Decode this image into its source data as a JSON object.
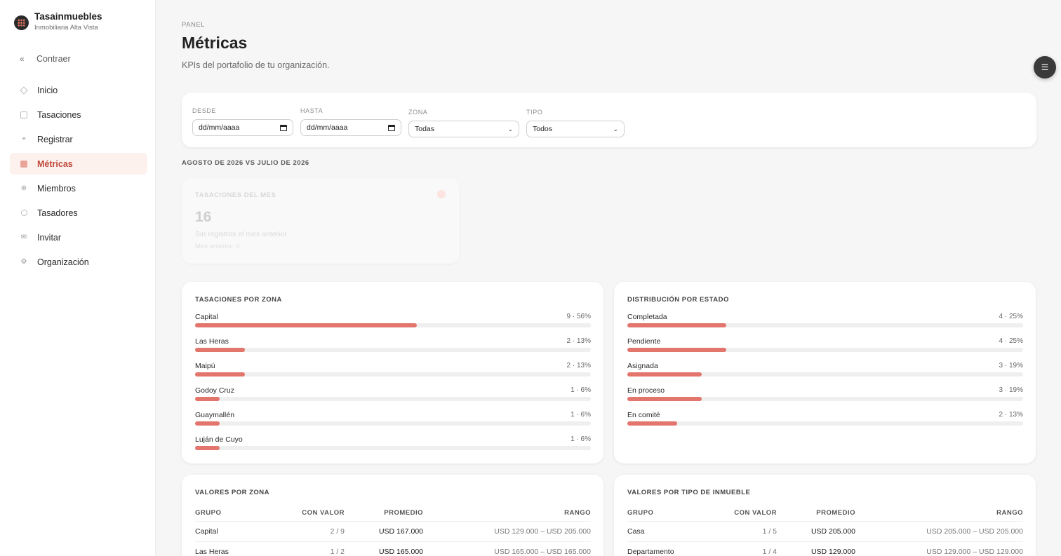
{
  "brand": {
    "name": "Tasainmuebles",
    "org": "Inmobiliaria Alta Vista"
  },
  "sidebar": {
    "collapse_label": "Contraer",
    "items": [
      {
        "label": "Inicio",
        "icon": "home-icon"
      },
      {
        "label": "Tasaciones",
        "icon": "list-icon"
      },
      {
        "label": "Registrar",
        "icon": "plus-icon"
      },
      {
        "label": "Métricas",
        "icon": "chart-icon",
        "active": true
      },
      {
        "label": "Miembros",
        "icon": "members-icon"
      },
      {
        "label": "Tasadores",
        "icon": "appraisers-icon"
      },
      {
        "label": "Invitar",
        "icon": "mail-icon"
      },
      {
        "label": "Organización",
        "icon": "gear-icon"
      }
    ]
  },
  "header": {
    "breadcrumb": "PANEL",
    "title": "Métricas",
    "subtitle": "KPIs del portafolio de tu organización."
  },
  "filters": {
    "desde": {
      "label": "DESDE",
      "value": "dd/mm/aaaa"
    },
    "hasta": {
      "label": "HASTA",
      "value": "dd/mm/aaaa"
    },
    "zona": {
      "label": "ZONA",
      "value": "Todas"
    },
    "tipo": {
      "label": "TIPO",
      "value": "Todos"
    }
  },
  "period_label": "AGOSTO DE 2026 VS JULIO DE 2026",
  "kpi": {
    "label": "TASACIONES DEL MES",
    "value": "16",
    "note": "Sin registros el mes anterior",
    "previous": "Mes anterior: 0"
  },
  "zones_card": {
    "title": "TASACIONES POR ZONA",
    "rows": [
      {
        "name": "Capital",
        "value": "9 · 56%",
        "pct": 56
      },
      {
        "name": "Las Heras",
        "value": "2 · 13%",
        "pct": 12.5
      },
      {
        "name": "Maipú",
        "value": "2 · 13%",
        "pct": 12.5
      },
      {
        "name": "Godoy Cruz",
        "value": "1 · 6%",
        "pct": 6.25
      },
      {
        "name": "Guaymallén",
        "value": "1 · 6%",
        "pct": 6.25
      },
      {
        "name": "Luján de Cuyo",
        "value": "1 · 6%",
        "pct": 6.25
      }
    ]
  },
  "status_card": {
    "title": "DISTRIBUCIÓN POR ESTADO",
    "rows": [
      {
        "name": "Completada",
        "value": "4 · 25%",
        "pct": 25
      },
      {
        "name": "Pendiente",
        "value": "4 · 25%",
        "pct": 25
      },
      {
        "name": "Asignada",
        "value": "3 · 19%",
        "pct": 18.75
      },
      {
        "name": "En proceso",
        "value": "3 · 19%",
        "pct": 18.75
      },
      {
        "name": "En comité",
        "value": "2 · 13%",
        "pct": 12.5
      }
    ]
  },
  "values_zone": {
    "title": "VALORES POR ZONA",
    "headers": [
      "GRUPO",
      "CON VALOR",
      "PROMEDIO",
      "RANGO"
    ],
    "rows": [
      [
        "Capital",
        "2 / 9",
        "USD 167.000",
        "USD 129.000 – USD 205.000"
      ],
      [
        "Las Heras",
        "1 / 2",
        "USD 165.000",
        "USD 165.000 – USD 165.000"
      ]
    ]
  },
  "values_type": {
    "title": "VALORES POR TIPO DE INMUEBLE",
    "headers": [
      "GRUPO",
      "CON VALOR",
      "PROMEDIO",
      "RANGO"
    ],
    "rows": [
      [
        "Casa",
        "1 / 5",
        "USD 205.000",
        "USD 205.000 – USD 205.000"
      ],
      [
        "Departamento",
        "1 / 4",
        "USD 129.000",
        "USD 129.000 – USD 129.000"
      ]
    ]
  },
  "colors": {
    "accent": "#e2756c",
    "active_text": "#c0493a",
    "active_bg": "#fdf1ee"
  }
}
